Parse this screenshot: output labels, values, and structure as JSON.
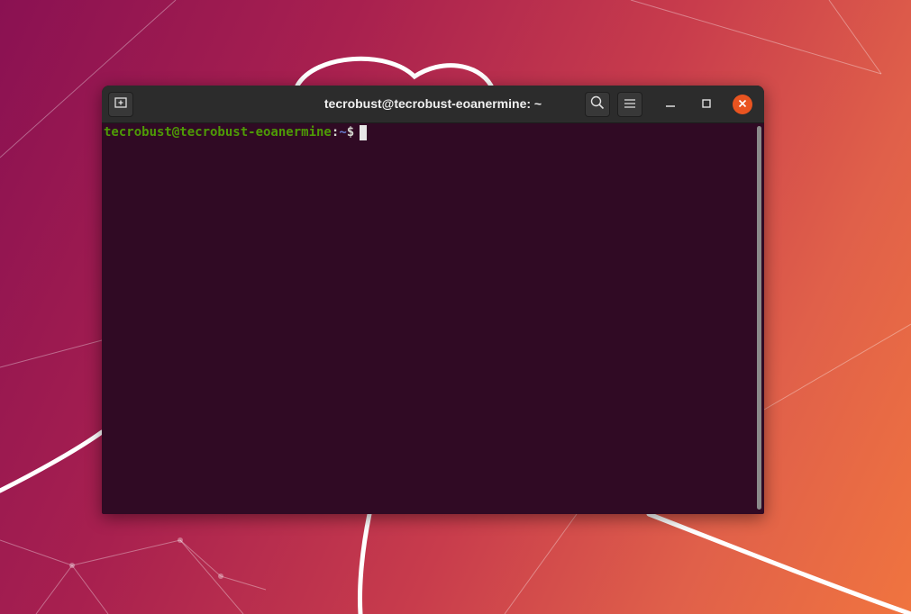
{
  "window": {
    "title": "tecrobust@tecrobust-eoanermine: ~"
  },
  "toolbar": {
    "new_tab_icon": "new-tab-icon",
    "search_icon": "search-icon",
    "menu_icon": "hamburger-menu-icon"
  },
  "controls": {
    "minimize_icon": "minimize-icon",
    "maximize_icon": "maximize-icon",
    "close_icon": "close-icon",
    "close_color": "#e95420"
  },
  "terminal": {
    "user_host": "tecrobust@tecrobust-eoanermine",
    "separator": ":",
    "path": "~",
    "symbol": "$",
    "background": "#300a24"
  }
}
